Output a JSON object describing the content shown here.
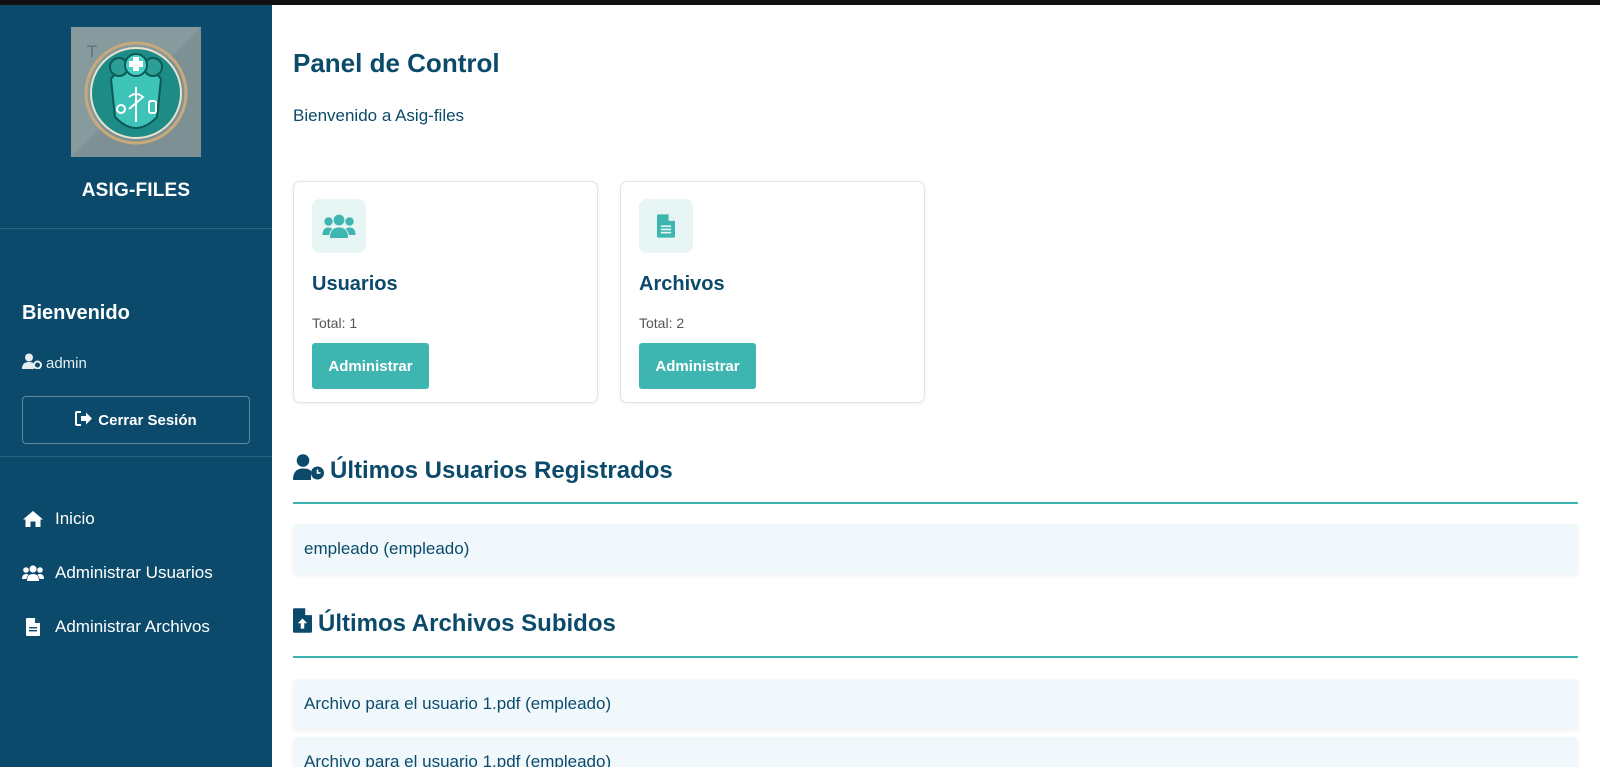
{
  "sidebar": {
    "brand": "ASIG-FILES",
    "welcome": "Bienvenido",
    "username": "admin",
    "logout_label": "Cerrar Sesión",
    "nav": [
      {
        "label": "Inicio",
        "icon": "home-icon"
      },
      {
        "label": "Administrar Usuarios",
        "icon": "users-icon"
      },
      {
        "label": "Administrar Archivos",
        "icon": "file-icon"
      }
    ],
    "bg_color": "#0b4a6b"
  },
  "main": {
    "title": "Panel de Control",
    "subtitle": "Bienvenido a Asig-files",
    "cards": [
      {
        "title": "Usuarios",
        "total": "Total: 1",
        "button": "Administrar",
        "icon": "users-icon"
      },
      {
        "title": "Archivos",
        "total": "Total: 2",
        "button": "Administrar",
        "icon": "file-icon"
      }
    ],
    "recent_users": {
      "title": "Últimos Usuarios Registrados",
      "icon": "user-clock-icon",
      "items": [
        "empleado (empleado)"
      ]
    },
    "recent_files": {
      "title": "Últimos Archivos Subidos",
      "icon": "file-upload-icon",
      "items": [
        "Archivo para el usuario 1.pdf (empleado)",
        "Archivo para el usuario 1.pdf (empleado)"
      ]
    },
    "accent_color": "#3eb5b1"
  }
}
